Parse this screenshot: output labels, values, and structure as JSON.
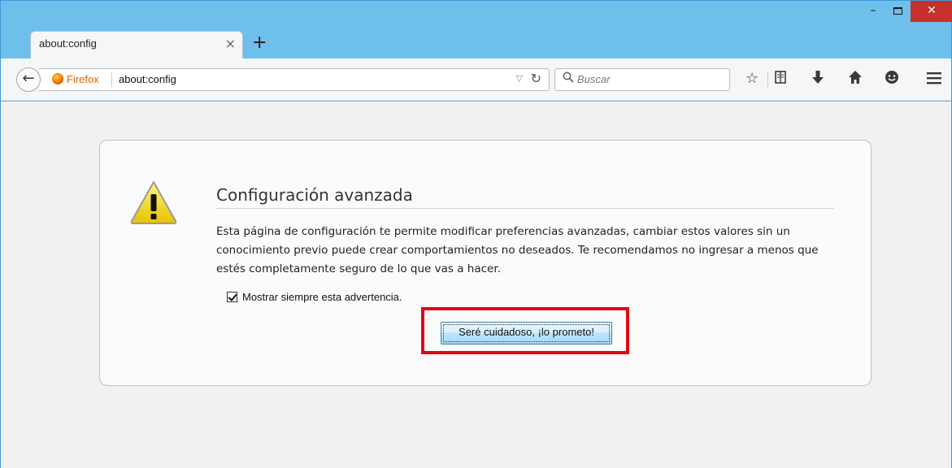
{
  "browser": {
    "tab": {
      "title": "about:config",
      "close_glyph": "×"
    },
    "new_tab_glyph": "+",
    "window_controls": {
      "minimize": "–",
      "close": "✕"
    },
    "navbar": {
      "identity_label": "Firefox",
      "url": "about:config",
      "search_placeholder": "Buscar"
    },
    "icons": [
      "back-icon",
      "reload-icon",
      "search-icon",
      "bookmark-star-icon",
      "reading-list-icon",
      "download-icon",
      "home-icon",
      "hello-icon",
      "menu-icon"
    ]
  },
  "warning_page": {
    "title": "Configuración avanzada",
    "description": "Esta página de configuración te permite modificar preferencias avanzadas, cambiar estos valores sin un conocimiento previo puede crear comportamientos no deseados. Te recomendamos no ingresar a menos que estés completamente seguro de lo que vas a hacer.",
    "checkbox_label": "Mostrar siempre esta advertencia.",
    "checkbox_checked": true,
    "button_label": "Seré cuidadoso, ¡lo prometo!"
  },
  "colors": {
    "titlebar": "#6ebfec",
    "highlight_box": "#e30613",
    "firefox_orange": "#e66000",
    "close_button": "#c7302b"
  }
}
